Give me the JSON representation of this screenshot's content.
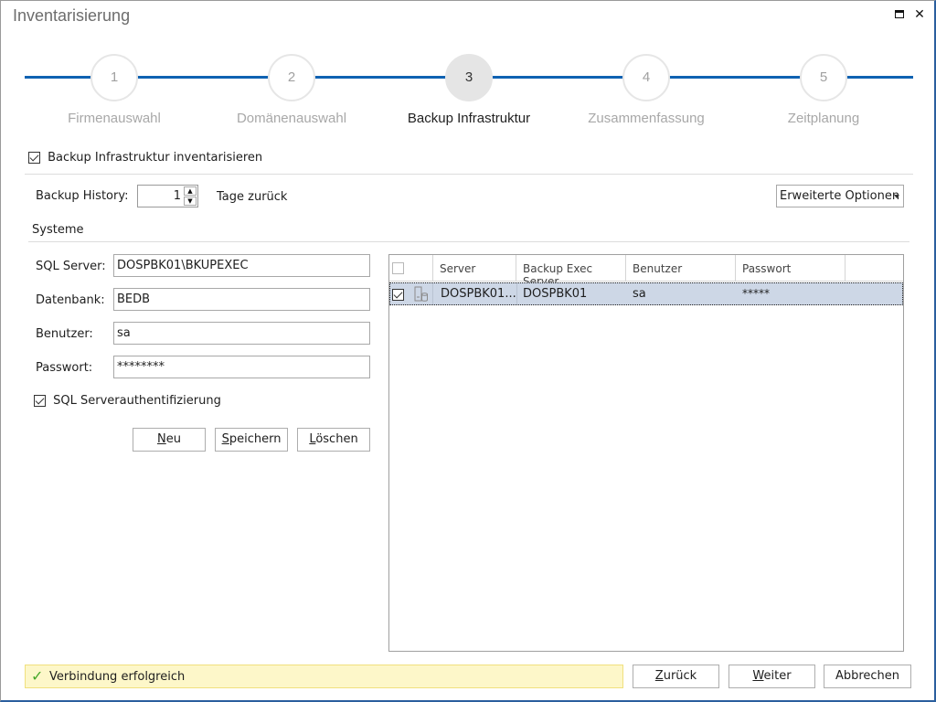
{
  "window": {
    "title": "Inventarisierung",
    "controls": {
      "maximize": "maximize-icon",
      "close": "close-icon",
      "close_glyph": "✕"
    }
  },
  "wizard": {
    "steps": [
      {
        "number": "1",
        "label": "Firmenauswahl",
        "active": false
      },
      {
        "number": "2",
        "label": "Domänenauswahl",
        "active": false
      },
      {
        "number": "3",
        "label": "Backup Infrastruktur",
        "active": true
      },
      {
        "number": "4",
        "label": "Zusammenfassung",
        "active": false
      },
      {
        "number": "5",
        "label": "Zeitplanung",
        "active": false
      }
    ],
    "line_color": "#0f62b2"
  },
  "inventory_checkbox": {
    "label": "Backup Infrastruktur inventarisieren",
    "checked": true
  },
  "backup_history": {
    "label": "Backup History:",
    "value": "1",
    "suffix": "Tage zurück",
    "up": "▲",
    "down": "▼"
  },
  "advanced_options": {
    "label": "Erweiterte Optionen"
  },
  "systems": {
    "section_title": "Systeme",
    "fields": {
      "sql_server": {
        "label": "SQL Server:",
        "value": "DOSPBK01\\BKUPEXEC"
      },
      "database": {
        "label": "Datenbank:",
        "value": "BEDB"
      },
      "user": {
        "label": "Benutzer:",
        "value": "sa"
      },
      "password": {
        "label": "Passwort:",
        "value": "********"
      }
    },
    "sql_auth": {
      "label": "SQL Serverauthentifizierung",
      "checked": true
    },
    "buttons": {
      "new": {
        "accel": "N",
        "rest": "eu"
      },
      "save": {
        "accel": "S",
        "rest": "peichern"
      },
      "delete": {
        "accel": "L",
        "rest": "öschen"
      }
    }
  },
  "table": {
    "columns": [
      "Server",
      "Backup Exec Server",
      "Benutzer",
      "Passwort"
    ],
    "rows": [
      {
        "checked": true,
        "icon": "server-database-icon",
        "server": "DOSPBK01....",
        "backup_exec_server": "DOSPBK01",
        "user": "sa",
        "password": "*****",
        "selected": true
      }
    ]
  },
  "status": {
    "icon": "checkmark-icon",
    "glyph": "✓",
    "text": "Verbindung erfolgreich",
    "color": "#fdf7c9"
  },
  "footer": {
    "back": {
      "accel": "Z",
      "rest": "urück"
    },
    "next": {
      "accel": "W",
      "rest": "eiter"
    },
    "cancel": {
      "label": "Abbrechen"
    }
  }
}
